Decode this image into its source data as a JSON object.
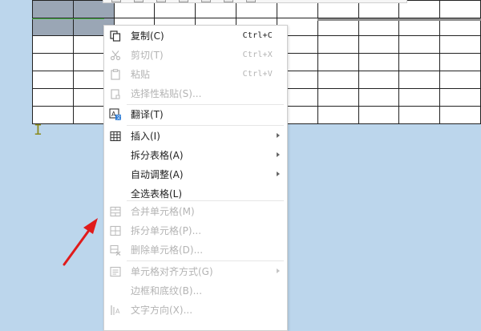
{
  "context_menu": {
    "items": [
      {
        "id": "copy",
        "label": "复制(C)",
        "shortcut": "Ctrl+C",
        "icon": "copy-icon",
        "enabled": true,
        "submenu": false
      },
      {
        "id": "cut",
        "label": "剪切(T)",
        "shortcut": "Ctrl+X",
        "icon": "scissors-icon",
        "enabled": false,
        "submenu": false
      },
      {
        "id": "paste",
        "label": "粘贴",
        "shortcut": "Ctrl+V",
        "icon": "clipboard-icon",
        "enabled": false,
        "submenu": false
      },
      {
        "id": "paste-special",
        "label": "选择性粘贴(S)...",
        "shortcut": "",
        "icon": "paste-special-icon",
        "enabled": false,
        "submenu": false
      },
      {
        "id": "translate",
        "label": "翻译(T)",
        "shortcut": "",
        "icon": "translate-icon",
        "enabled": true,
        "submenu": false
      },
      {
        "id": "insert",
        "label": "插入(I)",
        "shortcut": "",
        "icon": "table-insert-icon",
        "enabled": true,
        "submenu": true
      },
      {
        "id": "split-table",
        "label": "拆分表格(A)",
        "shortcut": "",
        "icon": "",
        "enabled": true,
        "submenu": true
      },
      {
        "id": "autofit",
        "label": "自动调整(A)",
        "shortcut": "",
        "icon": "",
        "enabled": true,
        "submenu": true
      },
      {
        "id": "select-table",
        "label": "全选表格(L)",
        "shortcut": "",
        "icon": "",
        "enabled": true,
        "submenu": false
      },
      {
        "id": "merge-cells",
        "label": "合并单元格(M)",
        "shortcut": "",
        "icon": "merge-cells-icon",
        "enabled": false,
        "submenu": false
      },
      {
        "id": "split-cells",
        "label": "拆分单元格(P)...",
        "shortcut": "",
        "icon": "split-cells-icon",
        "enabled": false,
        "submenu": false
      },
      {
        "id": "delete-cells",
        "label": "删除单元格(D)...",
        "shortcut": "",
        "icon": "delete-cells-icon",
        "enabled": false,
        "submenu": false
      },
      {
        "id": "cell-align",
        "label": "单元格对齐方式(G)",
        "shortcut": "",
        "icon": "cell-align-icon",
        "enabled": false,
        "submenu": true
      },
      {
        "id": "borders-shading",
        "label": "边框和底纹(B)...",
        "shortcut": "",
        "icon": "",
        "enabled": false,
        "submenu": false
      },
      {
        "id": "text-direction",
        "label": "文字方向(X)...",
        "shortcut": "",
        "icon": "text-direction-icon",
        "enabled": false,
        "submenu": false
      }
    ]
  },
  "colors": {
    "page_background": "#bcd6ec",
    "selected_cells": "#9aa6b5",
    "annotation_arrow": "#e01b1b",
    "disabled_text": "#b4b4b4"
  },
  "table": {
    "rows": 7,
    "visible_columns": 11
  }
}
